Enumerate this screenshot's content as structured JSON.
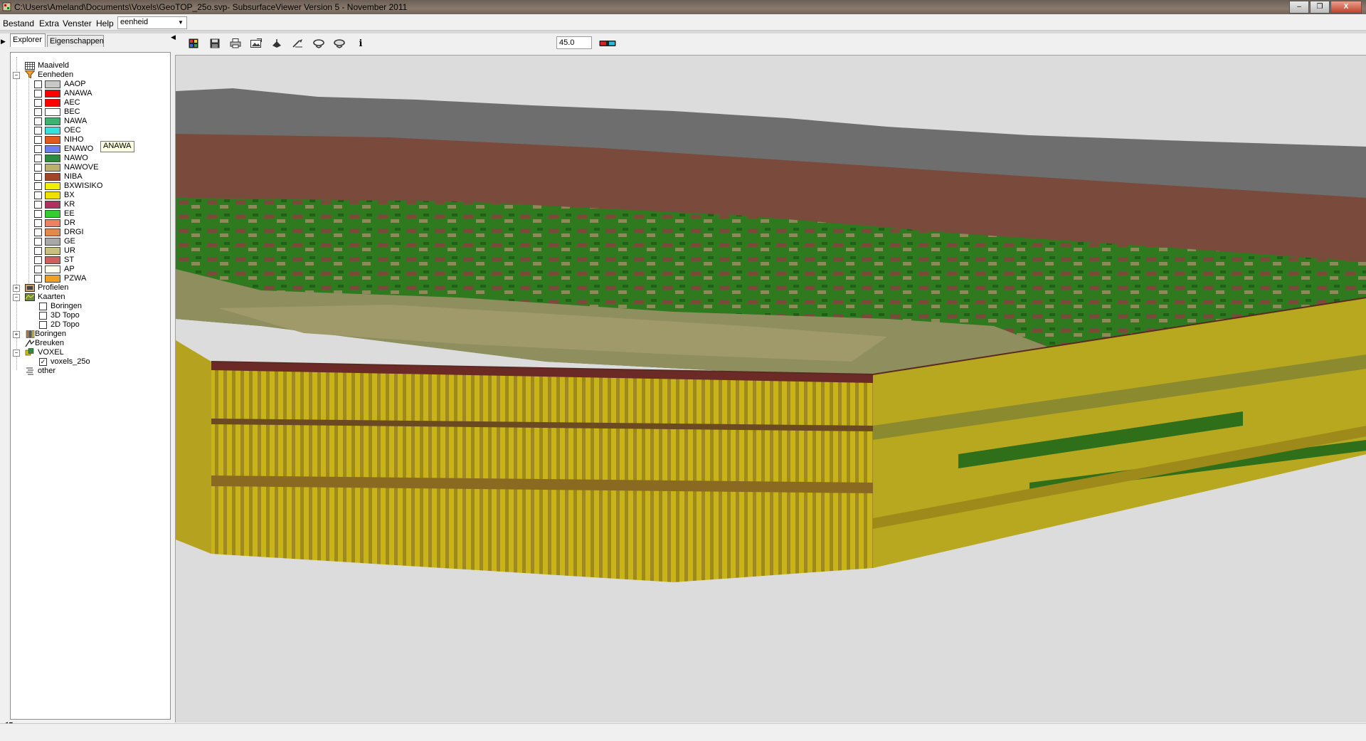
{
  "window": {
    "title": "C:\\Users\\Ameland\\Documents\\Voxels\\GeoTOP_25o.svp- SubsurfaceViewer Version 5 - November 2011",
    "controls": {
      "minimize": "–",
      "maximize": "❐",
      "close": "X"
    }
  },
  "menubar": {
    "items": [
      "Bestand",
      "Extra",
      "Venster",
      "Help"
    ],
    "dropdown_value": "eenheid"
  },
  "tabs": [
    "Explorer",
    "Eigenschappen"
  ],
  "tree": {
    "maaiveld": "Maaiveld",
    "eenheden": "Eenheden",
    "units": [
      {
        "label": "AAOP",
        "color": "#c8c8c8"
      },
      {
        "label": "ANAWA",
        "color": "#ff0000"
      },
      {
        "label": "AEC",
        "color": "#ff0000"
      },
      {
        "label": "BEC",
        "color": "#ffffff"
      },
      {
        "label": "NAWA",
        "color": "#3cb371"
      },
      {
        "label": "OEC",
        "color": "#33e0e0"
      },
      {
        "label": "NIHO",
        "color": "#e05a1e"
      },
      {
        "label": "ENAWO",
        "color": "#6b7ef0"
      },
      {
        "label": "NAWO",
        "color": "#2e8b3c"
      },
      {
        "label": "NAWOVE",
        "color": "#bdb06a"
      },
      {
        "label": "NIBA",
        "color": "#a0442c"
      },
      {
        "label": "BXWISIKO",
        "color": "#f0f000"
      },
      {
        "label": "BX",
        "color": "#f0e000"
      },
      {
        "label": "KR",
        "color": "#b03060"
      },
      {
        "label": "EE",
        "color": "#33cc33"
      },
      {
        "label": "DR",
        "color": "#f08060"
      },
      {
        "label": "DRGI",
        "color": "#e08a50"
      },
      {
        "label": "GE",
        "color": "#a8a8a8"
      },
      {
        "label": "UR",
        "color": "#c8c080"
      },
      {
        "label": "ST",
        "color": "#d06060"
      },
      {
        "label": "AP",
        "color": "#fffff0"
      },
      {
        "label": "PZWA",
        "color": "#f0a020"
      }
    ],
    "profielen": "Profielen",
    "kaarten": "Kaarten",
    "kaarten_items": [
      "Boringen",
      "3D Topo",
      "2D Topo"
    ],
    "boringen": "Boringen",
    "breuken": "Breuken",
    "voxel": "VOXEL",
    "voxel_items": [
      "voxels_25o"
    ],
    "other": "other"
  },
  "tooltip": "ANAWA",
  "toolbar": {
    "icons": [
      "legend-icon",
      "save-icon",
      "print-icon",
      "export-image-icon",
      "pan-icon",
      "measure-icon",
      "rotate-left-icon",
      "rotate-right-icon",
      "info-icon"
    ],
    "angle_value": "45.0",
    "stereo_glasses": "3d-glasses-icon"
  }
}
